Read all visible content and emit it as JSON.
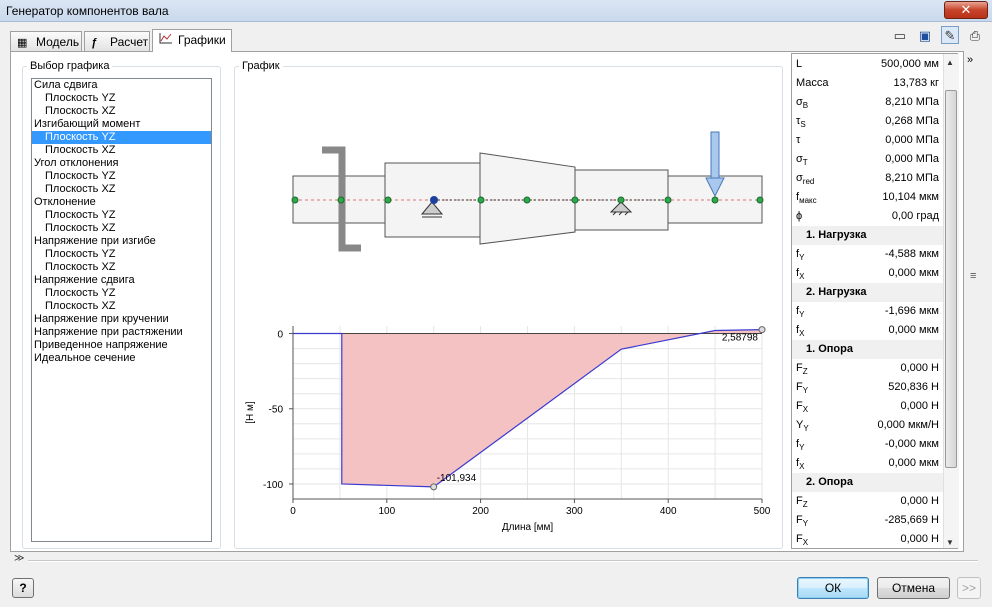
{
  "window": {
    "title": "Генератор компонентов вала",
    "close_glyph": "✕"
  },
  "tabs": [
    {
      "label": "Модель",
      "icon": "model-icon"
    },
    {
      "label": "Расчет",
      "icon": "formula-icon"
    },
    {
      "label": "Графики",
      "icon": "chart-icon",
      "active": true
    }
  ],
  "groups": {
    "select_label": "Выбор графика",
    "graph_label": "График"
  },
  "graph_list": [
    {
      "label": "Сила сдвига",
      "level": 0
    },
    {
      "label": "Плоскость YZ",
      "level": 1
    },
    {
      "label": "Плоскость XZ",
      "level": 1
    },
    {
      "label": "Изгибающий момент",
      "level": 0
    },
    {
      "label": "Плоскость YZ",
      "level": 1,
      "selected": true
    },
    {
      "label": "Плоскость XZ",
      "level": 1
    },
    {
      "label": "Угол отклонения",
      "level": 0
    },
    {
      "label": "Плоскость YZ",
      "level": 1
    },
    {
      "label": "Плоскость XZ",
      "level": 1
    },
    {
      "label": "Отклонение",
      "level": 0
    },
    {
      "label": "Плоскость YZ",
      "level": 1
    },
    {
      "label": "Плоскость XZ",
      "level": 1
    },
    {
      "label": "Напряжение при изгибе",
      "level": 0
    },
    {
      "label": "Плоскость YZ",
      "level": 1
    },
    {
      "label": "Плоскость XZ",
      "level": 1
    },
    {
      "label": "Напряжение сдвига",
      "level": 0
    },
    {
      "label": "Плоскость YZ",
      "level": 1
    },
    {
      "label": "Плоскость XZ",
      "level": 1
    },
    {
      "label": "Напряжение при кручении",
      "level": 0
    },
    {
      "label": "Напряжение при растяжении",
      "level": 0
    },
    {
      "label": "Приведенное напряжение",
      "level": 0
    },
    {
      "label": "Идеальное сечение",
      "level": 0
    }
  ],
  "properties": [
    {
      "name": "L",
      "value": "500,000 мм"
    },
    {
      "name": "Масса",
      "value": "13,783 кг"
    },
    {
      "name": "σ",
      "sub": "B",
      "value": "8,210 МПа"
    },
    {
      "name": "τ",
      "sub": "S",
      "value": "0,268 МПа"
    },
    {
      "name": "τ",
      "value": "0,000 МПа"
    },
    {
      "name": "σ",
      "sub": "T",
      "value": "0,000 МПа"
    },
    {
      "name": "σ",
      "sub": "red",
      "value": "8,210 МПа"
    },
    {
      "name": "f",
      "sub": "макс",
      "value": "10,104 мкм"
    },
    {
      "name": "ϕ",
      "value": "0,00 град"
    },
    {
      "header": "1. Нагрузка"
    },
    {
      "name": "f",
      "sub": "Y",
      "value": "-4,588 мкм"
    },
    {
      "name": "f",
      "sub": "X",
      "value": "0,000 мкм"
    },
    {
      "header": "2. Нагрузка"
    },
    {
      "name": "f",
      "sub": "Y",
      "value": "-1,696 мкм"
    },
    {
      "name": "f",
      "sub": "X",
      "value": "0,000 мкм"
    },
    {
      "header": "1. Опора"
    },
    {
      "name": "F",
      "sub": "Z",
      "value": "0,000 Н"
    },
    {
      "name": "F",
      "sub": "Y",
      "value": "520,836 Н"
    },
    {
      "name": "F",
      "sub": "X",
      "value": "0,000 Н"
    },
    {
      "name": "Y",
      "sub": "Y",
      "value": "0,000 мкм/Н"
    },
    {
      "name": "f",
      "sub": "Y",
      "value": "-0,000 мкм"
    },
    {
      "name": "f",
      "sub": "X",
      "value": "0,000 мкм"
    },
    {
      "header": "2. Опора"
    },
    {
      "name": "F",
      "sub": "Z",
      "value": "0,000 Н"
    },
    {
      "name": "F",
      "sub": "Y",
      "value": "-285,669 Н"
    },
    {
      "name": "F",
      "sub": "X",
      "value": "0,000 Н"
    }
  ],
  "buttons": {
    "help": "?",
    "ok": "ОК",
    "cancel": "Отмена",
    "more": ">>"
  },
  "chart_data": {
    "type": "area",
    "xlabel": "Длина [мм]",
    "ylabel": "[Н м]",
    "xlim": [
      0,
      500
    ],
    "ylim": [
      -110,
      5
    ],
    "xticks": [
      "0",
      "100",
      "200",
      "300",
      "400",
      "500"
    ],
    "yticks": [
      "0",
      "-50",
      "-100"
    ],
    "x": [
      0,
      52,
      52,
      150,
      350,
      450,
      500
    ],
    "y": [
      0,
      0,
      -100,
      -101.934,
      -10.4,
      2.0,
      2.58798
    ],
    "annotations": [
      {
        "x": 150,
        "y": -101.934,
        "text": "-101,934"
      },
      {
        "x": 500,
        "y": 2.58798,
        "text": "2,58798"
      }
    ],
    "fill_color": "#f4c2c2",
    "line_color": "#3a3ad0",
    "grid": true
  },
  "colors": {
    "selection": "#3399ff",
    "accent_arrow": "#6a9ad6"
  }
}
